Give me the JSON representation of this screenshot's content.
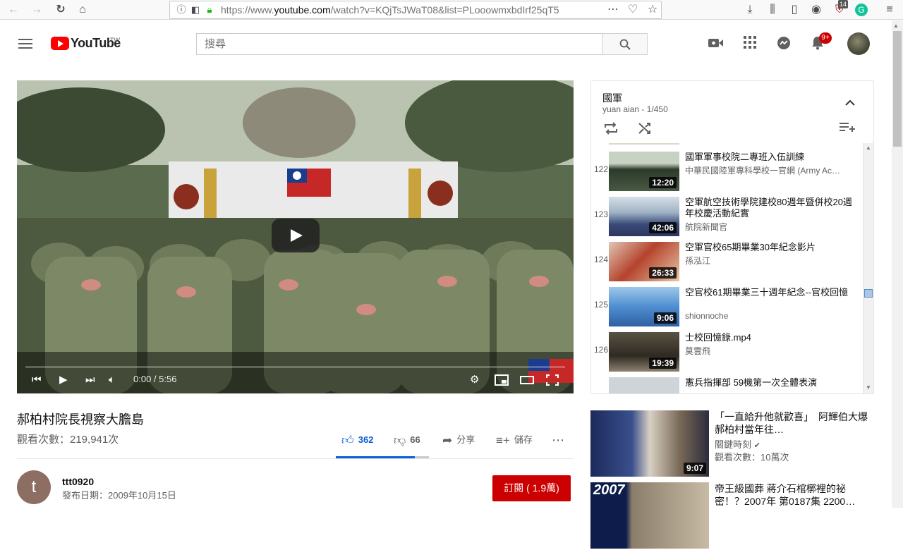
{
  "browser": {
    "url_prefix": "https://www.",
    "url_host": "youtube.com",
    "url_rest": "/watch?v=KQjTsJWaT08&list=PLooowmxbdIrf25qT5",
    "extension_badge": "14"
  },
  "header": {
    "logo_text": "YouTube",
    "logo_region": "TW",
    "search_placeholder": "搜尋",
    "notifications_count": "9+"
  },
  "player": {
    "time_current": "0:00",
    "time_sep": " / ",
    "time_total": "5:56",
    "progress": 0
  },
  "video": {
    "title": "郝柏村院長視察大膽島",
    "views": "觀看次數：219,941次",
    "likes": "362",
    "dislikes": "66",
    "share_label": "分享",
    "save_label": "儲存",
    "like_ratio": 0.85
  },
  "channel": {
    "avatar_letter": "t",
    "name": "ttt0920",
    "publish_date": "發布日期：2009年10月15日",
    "subscribe_label": "訂閱 ( 1.9萬)"
  },
  "playlist": {
    "title": "國軍",
    "subtitle": "yuan aian - 1/450",
    "items": [
      {
        "index": "122",
        "title": "國軍軍事校院二專班入伍訓練",
        "channel": "中華民國陸軍專科學校一官網 (Army Ac…",
        "duration": "12:20"
      },
      {
        "index": "123",
        "title": "空軍航空技術學院建校80週年暨併校20週年校慶活動紀實",
        "channel": "航院新聞官",
        "duration": "42:06"
      },
      {
        "index": "124",
        "title": "空軍官校65期畢業30年紀念影片",
        "channel": "孫泓江",
        "duration": "26:33"
      },
      {
        "index": "125",
        "title": "空官校61期畢業三十週年紀念--官校回憶",
        "channel": "shionnoche",
        "duration": "9:06"
      },
      {
        "index": "126",
        "title": "士校回憶錄.mp4",
        "channel": "莫雲飛",
        "duration": "19:39"
      },
      {
        "index": "",
        "title": "憲兵指揮部 59機第一次全體表演",
        "channel": "",
        "duration": ""
      }
    ]
  },
  "recommendations": [
    {
      "title": "「一直給升他就歡喜」　阿輝伯大爆郝柏村當年往…",
      "channel": "關鍵時刻",
      "meta": "觀看次數：10萬次",
      "duration": "9:07"
    },
    {
      "title": "帝王級國葬 蔣介石棺槨裡的祕密！？2007年 第0187集 2200…",
      "channel": "",
      "meta": "",
      "duration": "",
      "badge_text": "2007"
    }
  ]
}
